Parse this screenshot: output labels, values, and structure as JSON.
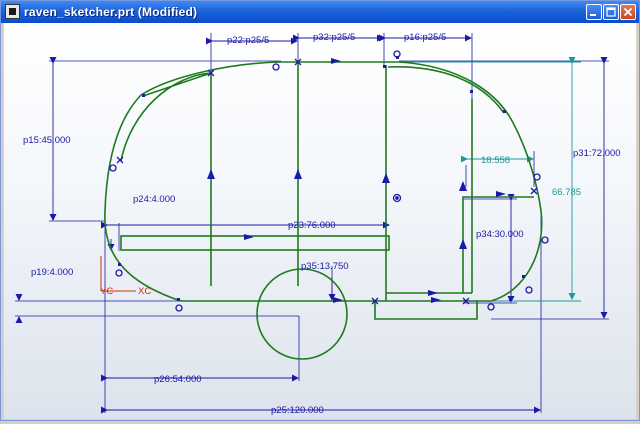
{
  "window": {
    "title": "raven_sketcher.prt (Modified)"
  },
  "colors": {
    "geometry": "#1e7a1e",
    "dimension": "#1a1aa6",
    "reference": "#1b9a9a",
    "constraint": "#1a1aa6",
    "axis_x": "#d03010",
    "axis_y": "#d03010"
  },
  "dimensions": {
    "p22": "p22:p25/5",
    "p32": "p32:p25/5",
    "p16": "p16:p25/5",
    "p15": "p15:45.000",
    "p31": "p31:72.000",
    "p24": "p24:4.000",
    "p23": "p23:76.000",
    "p34": "p34:30.000",
    "p35": "p35:13.750",
    "p19": "p19:4.000",
    "p26": "p26:54.000",
    "p25": "p25:120.000"
  },
  "reference_dimensions": {
    "r1": "18.558",
    "r2": "66.785"
  },
  "axes": {
    "x": "XC",
    "y": "YC"
  }
}
